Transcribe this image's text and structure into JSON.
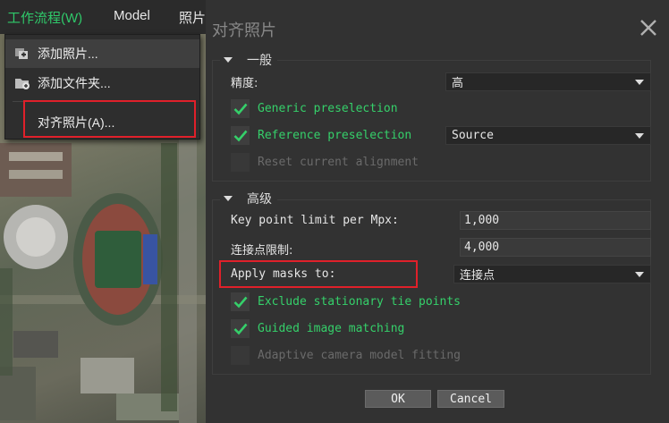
{
  "menubar": {
    "workflow": "工作流程(W)",
    "model": "Model",
    "photo": "照片"
  },
  "dropdown": {
    "add_photos": "添加照片...",
    "add_folder": "添加文件夹...",
    "align_photos": "对齐照片(A)..."
  },
  "dialog": {
    "title": "对齐照片",
    "general": {
      "header": "一般",
      "accuracy_label": "精度:",
      "accuracy_value": "高",
      "generic_preselection": "Generic preselection",
      "generic_checked": true,
      "reference_preselection": "Reference preselection",
      "reference_checked": true,
      "reference_mode": "Source",
      "reset_alignment": "Reset current alignment",
      "reset_checked": false
    },
    "advanced": {
      "header": "高级",
      "keypoint_label": "Key point limit per Mpx:",
      "keypoint_value": "1,000",
      "tiepoint_label": "连接点限制:",
      "tiepoint_value": "4,000",
      "masks_label": "Apply masks to:",
      "masks_value": "连接点",
      "exclude_stationary": "Exclude stationary tie points",
      "exclude_checked": true,
      "guided_matching": "Guided image matching",
      "guided_checked": true,
      "adaptive_fitting": "Adaptive camera model fitting",
      "adaptive_checked": false
    },
    "ok": "OK",
    "cancel": "Cancel"
  },
  "colors": {
    "accent_green": "#35d06a",
    "highlight_red": "#e0202a",
    "dialog_bg": "#323232"
  }
}
